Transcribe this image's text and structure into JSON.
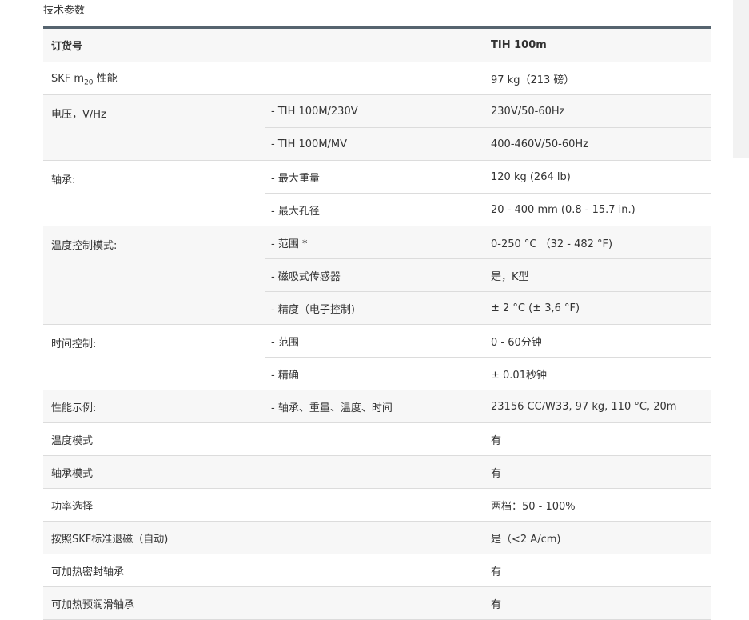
{
  "section_title": "技术参数",
  "header": {
    "label": "订货号",
    "model": "TIH 100m"
  },
  "rows": {
    "perf_prefix": "SKF m",
    "perf_sub": "20",
    "perf_suffix": " 性能",
    "perf_value": "97 kg（213 磅）",
    "voltage_label": "电压，V/Hz",
    "voltage_230_label": "- TIH 100M/230V",
    "voltage_230_value": "230V/50-60Hz",
    "voltage_mv_label": "- TIH 100M/MV",
    "voltage_mv_value": "400-460V/50-60Hz",
    "bearing_label": "轴承:",
    "bearing_weight_label": "- 最大重量",
    "bearing_weight_value": "120 kg (264 lb)",
    "bearing_bore_label": "- 最大孔径",
    "bearing_bore_value": "20 - 400 mm (0.8 - 15.7 in.)",
    "temp_mode_label": "温度控制模式:",
    "temp_range_label": "- 范围 *",
    "temp_range_value": "0-250 °C （32 - 482 °F)",
    "temp_sensor_label": "- 磁吸式传感器",
    "temp_sensor_value": "是，K型",
    "temp_accuracy_label": "- 精度（电子控制)",
    "temp_accuracy_value": "± 2 °C (± 3,6 °F)",
    "time_label": "时间控制:",
    "time_range_label": "- 范围",
    "time_range_value": "0 - 60分钟",
    "time_accuracy_label": "- 精确",
    "time_accuracy_value": "± 0.01秒钟",
    "example_label": "性能示例:",
    "example_sub_label": "- 轴承、重量、温度、时间",
    "example_value": "23156 CC/W33, 97 kg, 110 °C, 20m",
    "temp_mode2_label": "温度模式",
    "temp_mode2_value": "有",
    "bearing_mode_label": "轴承模式",
    "bearing_mode_value": "有",
    "power_label": "功率选择",
    "power_value": "两档：50 - 100%",
    "demag_label": "按照SKF标准退磁（自动)",
    "demag_value": "是（<2 A/cm)",
    "seal_label": "可加热密封轴承",
    "seal_value": "有",
    "prelub_label": "可加热预润滑轴承",
    "prelub_value": "有"
  }
}
